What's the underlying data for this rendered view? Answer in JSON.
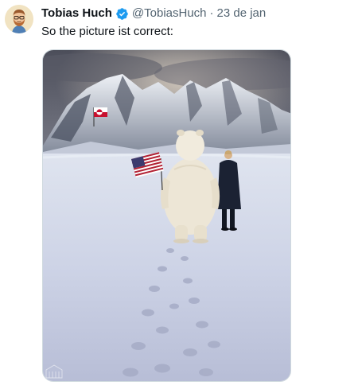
{
  "tweet": {
    "author": {
      "display_name": "Tobias Huch",
      "handle": "@TobiasHuch",
      "verified_icon": "verified-badge-icon",
      "avatar_icon": "bearded-man-avatar"
    },
    "separator": "·",
    "date": "23 de jan",
    "text": "So the picture ist correct:",
    "media": {
      "subject": "polar-bear-and-man-walking-on-snowfield-photo",
      "flags": [
        "us-flag",
        "greenland-flag"
      ]
    }
  },
  "colors": {
    "text_primary": "#0f1419",
    "text_secondary": "#536471",
    "verified_blue": "#1d9bf0",
    "border": "#cfd9de"
  }
}
